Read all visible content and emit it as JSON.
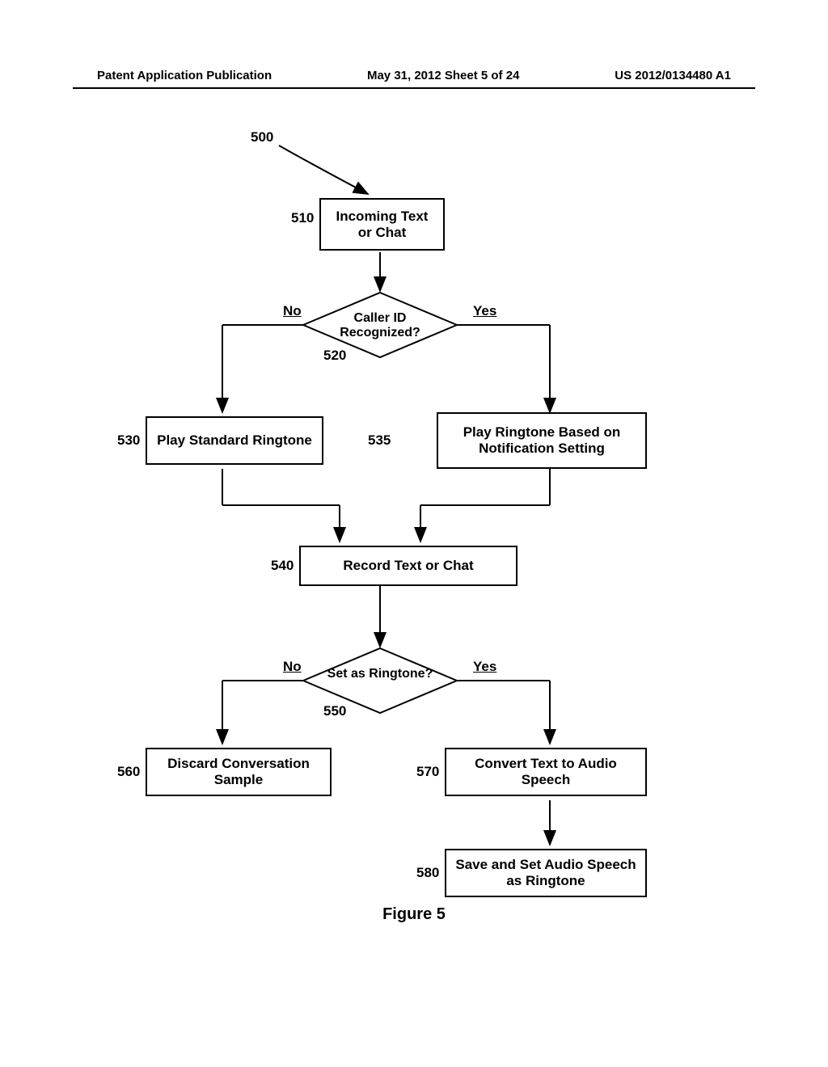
{
  "header": {
    "left": "Patent Application Publication",
    "center": "May 31, 2012  Sheet 5 of 24",
    "right": "US 2012/0134480 A1"
  },
  "labels": {
    "n500": "500",
    "n510": "510",
    "n520": "520",
    "n530": "530",
    "n535": "535",
    "n540": "540",
    "n550": "550",
    "n560": "560",
    "n570": "570",
    "n580": "580",
    "no1": "No",
    "yes1": "Yes",
    "no2": "No",
    "yes2": "Yes"
  },
  "boxes": {
    "b510": "Incoming Text or Chat",
    "b520": "Caller ID Recognized?",
    "b530": "Play Standard Ringtone",
    "b535": "Play Ringtone Based on Notification Setting",
    "b540": "Record Text or Chat",
    "b550": "Set as Ringtone?",
    "b560": "Discard Conversation Sample",
    "b570": "Convert Text to Audio Speech",
    "b580": "Save and Set Audio Speech as Ringtone"
  },
  "figure": "Figure 5"
}
